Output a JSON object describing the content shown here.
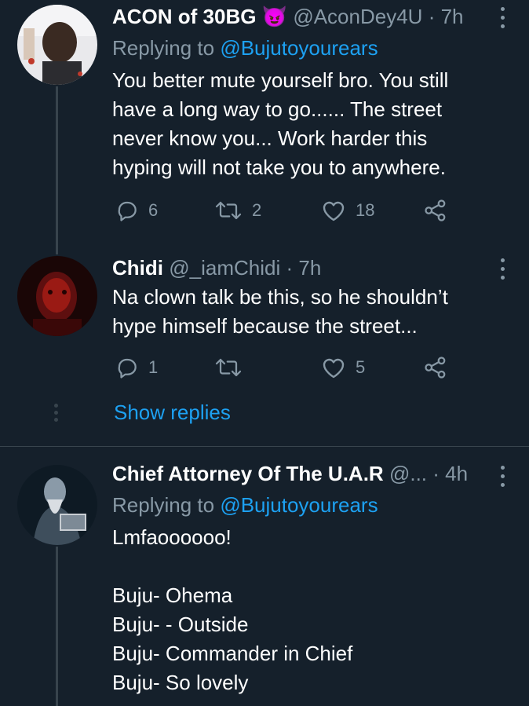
{
  "tweets": [
    {
      "name": "ACON of 30BG",
      "emoji": "😈",
      "handle": "@AconDey4U",
      "time": "7h",
      "replying_label": "Replying to",
      "replying_to": "@Bujutoyourears",
      "text": "You better mute yourself bro. You still\nhave a long way to go...... The street\nnever know you... Work harder this\nhyping will not take you to anywhere.",
      "replies": "6",
      "retweets": "2",
      "likes": "18"
    },
    {
      "name": "Chidi",
      "handle": "@_iamChidi",
      "time": "7h",
      "text": "Na clown talk be this, so he shouldn’t\nhype himself because the street...",
      "replies": "1",
      "retweets": "",
      "likes": "5",
      "show_replies": "Show replies"
    },
    {
      "name": "Chief Attorney Of The U.A.R",
      "handle": "@...",
      "time": "4h",
      "replying_label": "Replying to",
      "replying_to": "@Bujutoyourears",
      "text": "Lmfaoooooo!\n\nBuju- Ohema\nBuju- - Outside\nBuju- Commander in Chief\nBuju- So lovely"
    }
  ],
  "separator": "·",
  "icons": [
    "reply-icon",
    "retweet-icon",
    "like-icon",
    "share-icon",
    "more-icon"
  ],
  "colors": {
    "background": "#15202b",
    "text": "#ffffff",
    "muted": "#8899a6",
    "accent": "#1da1f2",
    "line": "#38444d"
  }
}
